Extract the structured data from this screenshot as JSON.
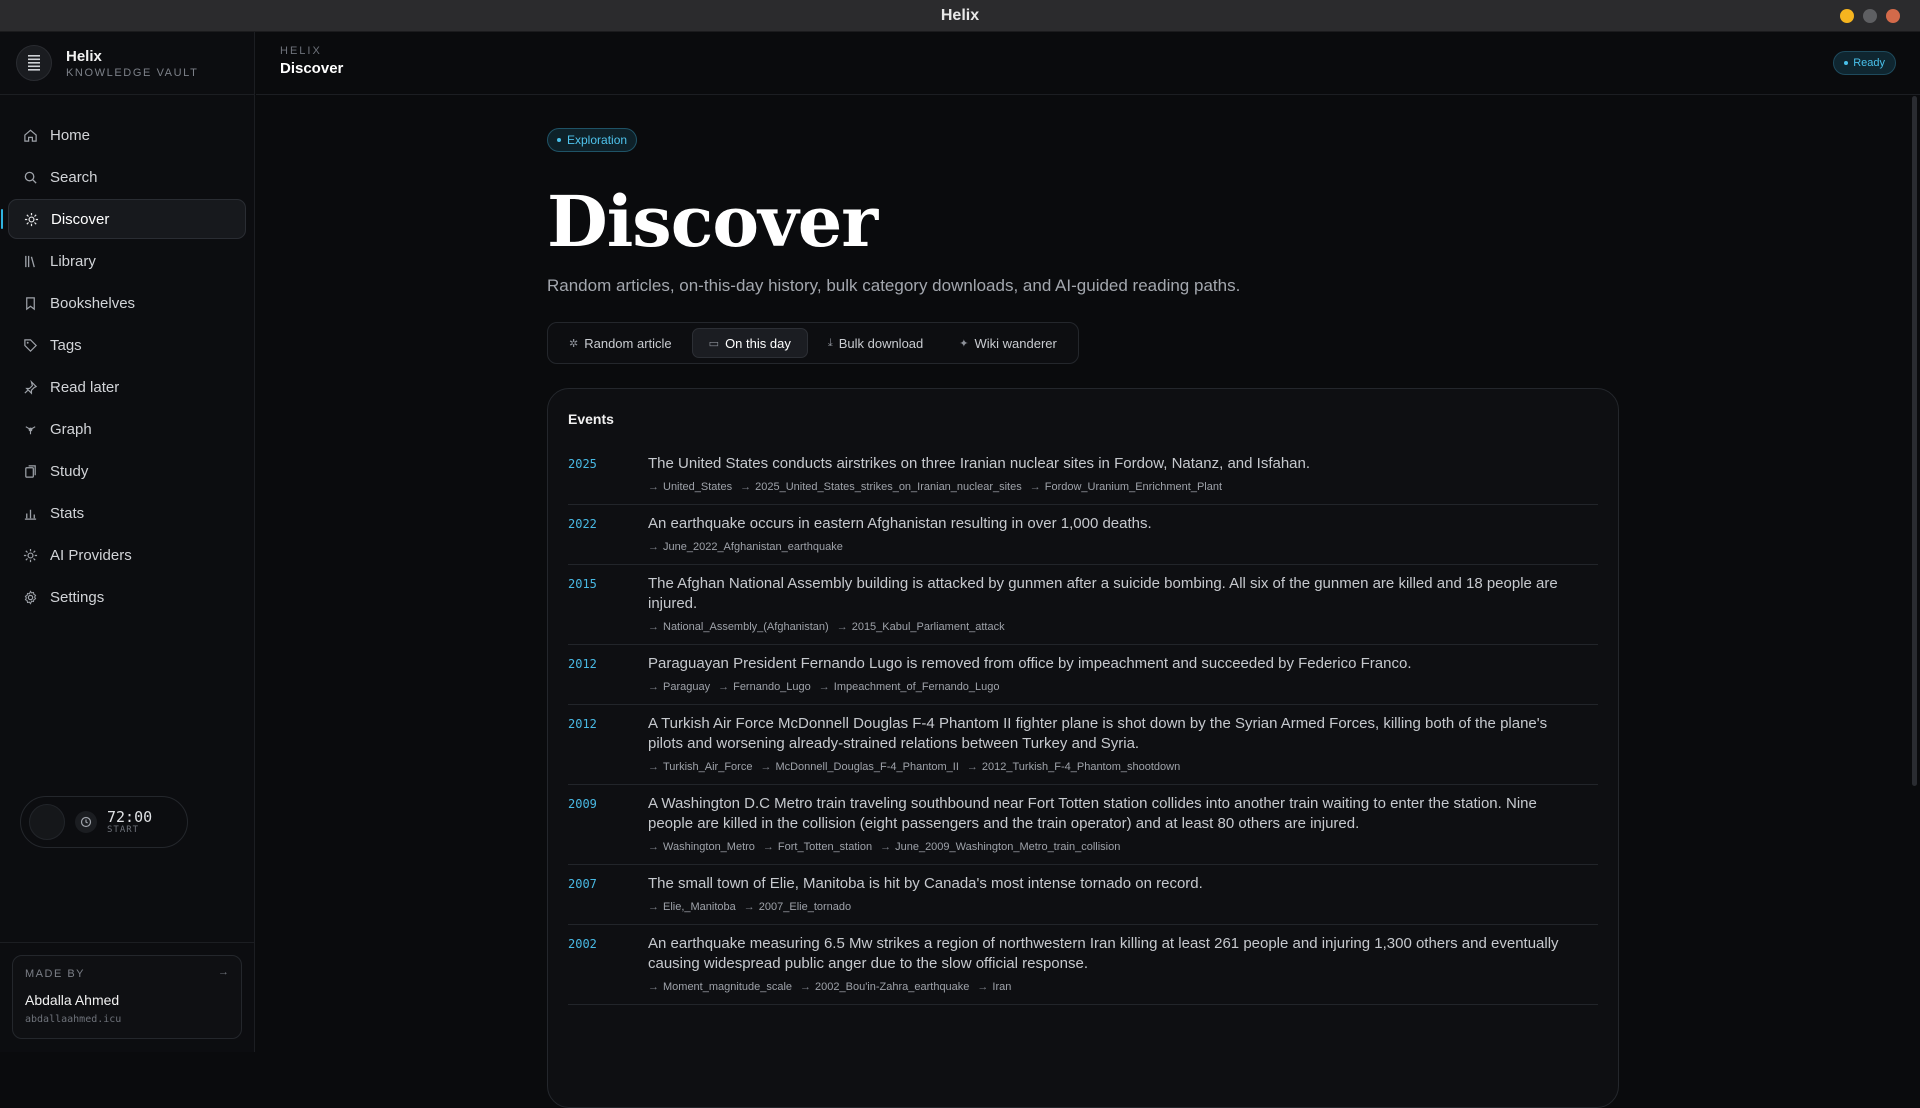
{
  "window": {
    "title": "Helix",
    "controls_colors": [
      "#f5b41f",
      "#5e5f62",
      "#d36a4a"
    ]
  },
  "brand": {
    "name": "Helix",
    "subtitle": "KNOWLEDGE VAULT"
  },
  "sidebar": {
    "items": [
      {
        "label": "Home",
        "icon": "home-icon",
        "active": false
      },
      {
        "label": "Search",
        "icon": "search-icon",
        "active": false
      },
      {
        "label": "Discover",
        "icon": "sparkle-icon",
        "active": true
      },
      {
        "label": "Library",
        "icon": "library-icon",
        "active": false
      },
      {
        "label": "Bookshelves",
        "icon": "bookmark-icon",
        "active": false
      },
      {
        "label": "Tags",
        "icon": "tag-icon",
        "active": false
      },
      {
        "label": "Read later",
        "icon": "pin-icon",
        "active": false
      },
      {
        "label": "Graph",
        "icon": "graph-icon",
        "active": false
      },
      {
        "label": "Study",
        "icon": "cards-icon",
        "active": false
      },
      {
        "label": "Stats",
        "icon": "bar-chart-icon",
        "active": false
      },
      {
        "label": "AI Providers",
        "icon": "sun-icon",
        "active": false
      },
      {
        "label": "Settings",
        "icon": "gear-icon",
        "active": false
      }
    ]
  },
  "timer": {
    "time": "72:00",
    "label": "START"
  },
  "madeby": {
    "label": "MADE BY",
    "name": "Abdalla Ahmed",
    "site": "abdallaahmed.icu",
    "arrow": "→"
  },
  "topbar": {
    "crumb": "HELIX",
    "title": "Discover",
    "status": "Ready"
  },
  "page": {
    "pill": "Exploration",
    "title": "Discover",
    "subtitle": "Random articles, on-this-day history, bulk category downloads, and AI-guided reading paths."
  },
  "tabs": [
    {
      "label": "Random article",
      "icon": "✲",
      "active": false
    },
    {
      "label": "On this day",
      "icon": "▭",
      "active": true
    },
    {
      "label": "Bulk download",
      "icon": "⤓",
      "active": false
    },
    {
      "label": "Wiki wanderer",
      "icon": "✦",
      "active": false
    }
  ],
  "events": {
    "title": "Events",
    "items": [
      {
        "year": "2025",
        "text": "The United States conducts airstrikes on three Iranian nuclear sites in Fordow, Natanz, and Isfahan.",
        "links": [
          "United_States",
          "2025_United_States_strikes_on_Iranian_nuclear_sites",
          "Fordow_Uranium_Enrichment_Plant"
        ]
      },
      {
        "year": "2022",
        "text": "An earthquake occurs in eastern Afghanistan resulting in over 1,000 deaths.",
        "links": [
          "June_2022_Afghanistan_earthquake"
        ]
      },
      {
        "year": "2015",
        "text": "The Afghan National Assembly building is attacked by gunmen after a suicide bombing. All six of the gunmen are killed and 18 people are injured.",
        "links": [
          "National_Assembly_(Afghanistan)",
          "2015_Kabul_Parliament_attack"
        ]
      },
      {
        "year": "2012",
        "text": "Paraguayan President Fernando Lugo is removed from office by impeachment and succeeded by Federico Franco.",
        "links": [
          "Paraguay",
          "Fernando_Lugo",
          "Impeachment_of_Fernando_Lugo"
        ]
      },
      {
        "year": "2012",
        "text": "A Turkish Air Force McDonnell Douglas F-4 Phantom II fighter plane is shot down by the Syrian Armed Forces, killing both of the plane's pilots and worsening already-strained relations between Turkey and Syria.",
        "links": [
          "Turkish_Air_Force",
          "McDonnell_Douglas_F-4_Phantom_II",
          "2012_Turkish_F-4_Phantom_shootdown"
        ]
      },
      {
        "year": "2009",
        "text": "A Washington D.C Metro train traveling southbound near Fort Totten station collides into another train waiting to enter the station. Nine people are killed in the collision (eight passengers and the train operator) and at least 80 others are injured.",
        "links": [
          "Washington_Metro",
          "Fort_Totten_station",
          "June_2009_Washington_Metro_train_collision"
        ]
      },
      {
        "year": "2007",
        "text": "The small town of Elie, Manitoba is hit by Canada's most intense tornado on record.",
        "links": [
          "Elie,_Manitoba",
          "2007_Elie_tornado"
        ]
      },
      {
        "year": "2002",
        "text": "An earthquake measuring 6.5 Mw strikes a region of northwestern Iran killing at least 261 people and injuring 1,300 others and eventually causing widespread public anger due to the slow official response.",
        "links": [
          "Moment_magnitude_scale",
          "2002_Bou'in-Zahra_earthquake",
          "Iran"
        ]
      }
    ]
  },
  "colors": {
    "accent": "#2fb3e0",
    "background": "#0a0b0d",
    "card": "#0e0f12"
  }
}
